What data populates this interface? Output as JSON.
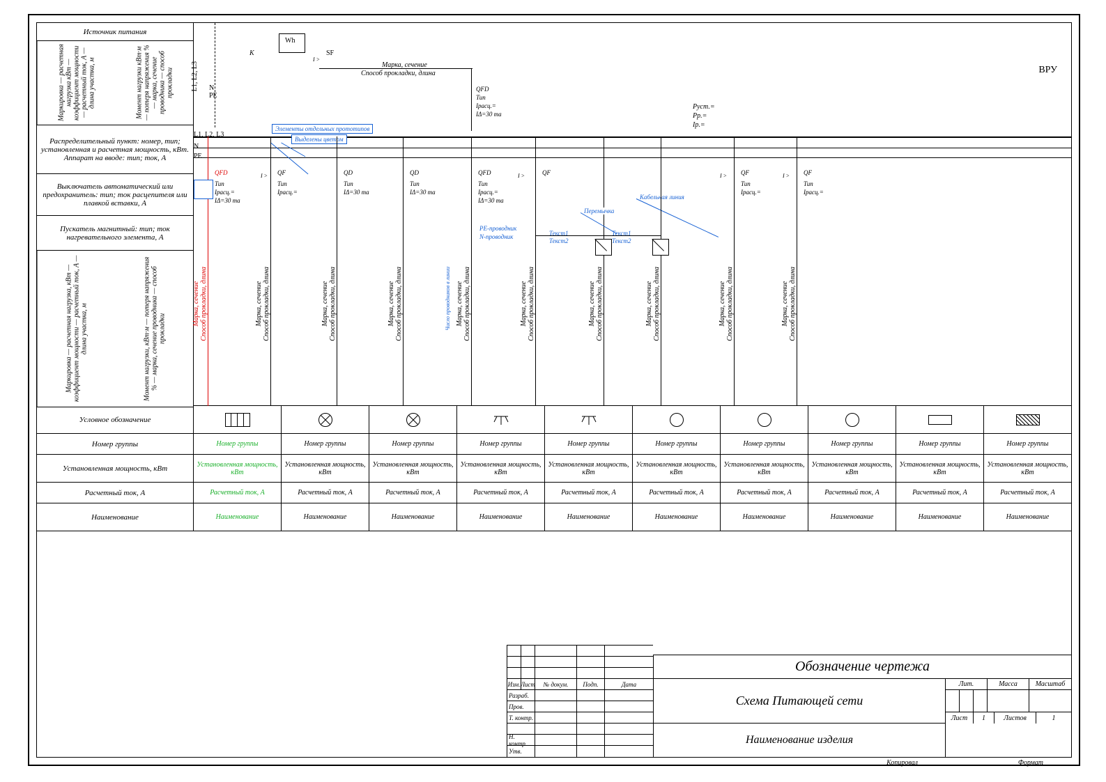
{
  "legend": {
    "source": "Источник питания",
    "split1_left": "Маркировка — расчетная нагрузка кВт — коэффициент мощности — расчетный ток, А — длина участка, м",
    "split1_right": "Момент нагрузки кВт·м — потеря напряжения % — марка, сечение проводника — способ прокладки",
    "dist_point": "Распределительный пункт: номер, тип; установленная и расчетная мощность, кВт.\nАппарат на вводе: тип; ток, А",
    "breaker": "Выключатель автоматический или предохранитель: тип; ток расцепителя или плавкой вставки, А",
    "starter": "Пускатель магнитный: тип; ток нагревательного элемента, А",
    "split2_left": "Маркировка — расчетная нагрузка, кВт — коэффициент мощности — расчетный ток, А — длина участка, м",
    "split2_right": "Момент нагрузки, кВт·м — потеря напряжения % — марка, сечение проводника — способ прокладки"
  },
  "rowheads": {
    "symbol": "Условное обозначение",
    "group": "Номер группы",
    "power": "Установленная мощность, кВт",
    "current": "Расчетный ток, А",
    "name": "Наименование"
  },
  "cell_labels": {
    "group": "Номер группы",
    "power": "Установленная мощность, кВт",
    "current": "Расчетный ток, А",
    "name": "Наименование"
  },
  "columns_count": 10,
  "schematic": {
    "buses": "L1, L2, L3",
    "bus_n": "N",
    "bus_pe": "PE",
    "k": "K",
    "wh": "Wh",
    "sf": "SF",
    "i_gt": "I >",
    "mark_section": "Марка, сечение",
    "lay_length": "Способ прокладки, длина",
    "vru": "ВРУ",
    "qfd": "QFD",
    "qf": "QF",
    "qd": "QD",
    "tun": "Тип",
    "irasc": "Iрасц.=",
    "idelta": "IΔ=30 mа",
    "elements_note": "Элементы отдельных прототипов",
    "highlighted_note": "Выделены цветом",
    "pe_cond": "PE-проводник",
    "n_cond": "N-проводник",
    "wires_count": "Число проводников в линии",
    "cable_line": "Кабельная линия",
    "jumper": "Перемычка",
    "text1": "Текст1",
    "text2": "Текст2",
    "p_ust": "Pуст.=",
    "p_p": "Pр.=",
    "i_p": "Iр.=",
    "cable_v_label": "Марка, сечение\nСпособ прокладки, длина"
  },
  "titleblock": {
    "designation": "Обозначение чертежа",
    "title": "Схема Питающей сети",
    "product": "Наименование изделия",
    "lit": "Лит.",
    "mass": "Масса",
    "scale": "Масштаб",
    "sheet": "Лист",
    "sheet_n": "1",
    "sheets": "Листов",
    "sheets_n": "1",
    "kopiroval": "Копировал",
    "format": "Формат"
  },
  "revblock": {
    "izm": "Изм.",
    "list": "Лист",
    "ndok": "№ докум.",
    "podp": "Подп.",
    "data": "Дата",
    "razrab": "Разраб.",
    "prov": "Пров.",
    "tkontr": "Т. контр.",
    "nkontr": "Н. контр.",
    "utv": "Утв."
  }
}
